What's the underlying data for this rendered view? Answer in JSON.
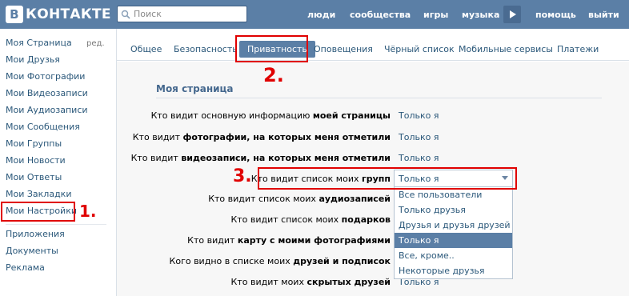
{
  "header": {
    "logo_mark": "В",
    "logo_text": "КОНТАКТЕ",
    "search_placeholder": "Поиск",
    "nav": [
      "люди",
      "сообщества",
      "игры",
      "музыка",
      "помощь",
      "выйти"
    ]
  },
  "sidebar": {
    "edit_label": "ред.",
    "items": [
      "Моя Страница",
      "Мои Друзья",
      "Мои Фотографии",
      "Мои Видеозаписи",
      "Мои Аудиозаписи",
      "Мои Сообщения",
      "Мои Группы",
      "Мои Новости",
      "Мои Ответы",
      "Мои Закладки",
      "Мои Настройки"
    ],
    "extra_items": [
      "Приложения",
      "Документы",
      "Реклама"
    ]
  },
  "tabs": [
    "Общее",
    "Безопасность",
    "Приватность",
    "Оповещения",
    "Чёрный список",
    "Мобильные сервисы",
    "Платежи"
  ],
  "active_tab": "Приватность",
  "section_title": "Моя страница",
  "privacy_rows": [
    {
      "prefix": "Кто видит основную информацию ",
      "bold": "моей страницы",
      "value": "Только я"
    },
    {
      "prefix": "Кто видит ",
      "bold": "фотографии, на которых меня отметили",
      "value": "Только я"
    },
    {
      "prefix": "Кто видит ",
      "bold": "видеозаписи, на которых меня отметили",
      "value": "Только я"
    },
    {
      "prefix": "Кто видит список моих ",
      "bold": "групп",
      "value": "Только я"
    },
    {
      "prefix": "Кто видит список моих ",
      "bold": "аудиозаписей",
      "value": ""
    },
    {
      "prefix": "Кто видит список моих ",
      "bold": "подарков",
      "value": ""
    },
    {
      "prefix": "Кто видит ",
      "bold": "карту с моими фотографиями",
      "value": ""
    },
    {
      "prefix": "Кого видно в списке моих ",
      "bold": "друзей и подписок",
      "value": ""
    },
    {
      "prefix": "Кто видит моих ",
      "bold": "скрытых друзей",
      "value": "Только я"
    }
  ],
  "dropdown": {
    "selected": "Только я",
    "options": [
      "Все пользователи",
      "Только друзья",
      "Друзья и друзья друзей",
      "Только я",
      "Все, кроме..",
      "Некоторые друзья"
    ],
    "highlighted": "Только я"
  },
  "annotations": [
    "1.",
    "2.",
    "3."
  ],
  "colors": {
    "header": "#5b7fa6",
    "link": "#2b587a",
    "highlight": "#e00000"
  }
}
